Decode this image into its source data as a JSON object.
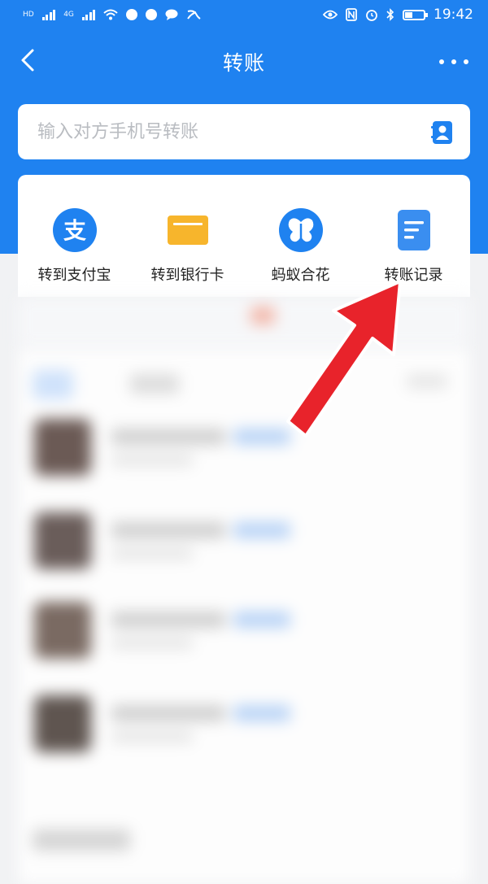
{
  "status_bar": {
    "network_1": "HD",
    "network_2": "4G",
    "time": "19:42"
  },
  "header": {
    "title": "转账",
    "back_icon": "chevron-left-icon",
    "more_icon": "more-dots-icon"
  },
  "search": {
    "placeholder": "输入对方手机号转账",
    "contact_icon": "contact-book-icon"
  },
  "actions": [
    {
      "label": "转到支付宝",
      "icon": "alipay-icon",
      "color": "#1f82f0"
    },
    {
      "label": "转到银行卡",
      "icon": "bank-card-icon",
      "color": "#f7b52c"
    },
    {
      "label": "蚂蚁合花",
      "icon": "butterfly-icon",
      "color": "#1f82f0"
    },
    {
      "label": "转账记录",
      "icon": "record-document-icon",
      "color": "#3a8ef0"
    }
  ],
  "colors": {
    "brand_blue": "#1f82f0",
    "card_yellow": "#f7b52c",
    "arrow_red": "#e8232b"
  }
}
